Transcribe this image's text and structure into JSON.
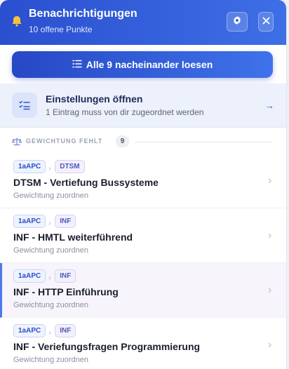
{
  "header": {
    "title": "Benachrichtigungen",
    "subtitle": "10 offene Punkte",
    "icons": {
      "bell": "bell-icon",
      "gear": "gear-icon",
      "close": "close-icon"
    }
  },
  "solve_button": {
    "label": "Alle 9 nacheinander loesen",
    "icon": "list-icon"
  },
  "settings_card": {
    "title": "Einstellungen öffnen",
    "subtitle": "1 Eintrag muss von dir zugeordnet werden",
    "arrow": "→"
  },
  "section": {
    "label": "GEWICHTUNG FEHLT",
    "count": "9",
    "icon": "scale-icon"
  },
  "items": [
    {
      "chip1": "1aAPC",
      "chip2": "DTSM",
      "title": "DTSM - Vertiefung Bussysteme",
      "subtitle": "Gewichtung zuordnen"
    },
    {
      "chip1": "1aAPC",
      "chip2": "INF",
      "title": "INF - HMTL weiterführend",
      "subtitle": "Gewichtung zuordnen"
    },
    {
      "chip1": "1aAPC",
      "chip2": "INF",
      "title": "INF - HTTP Einführung",
      "subtitle": "Gewichtung zuordnen"
    },
    {
      "chip1": "1aAPC",
      "chip2": "INF",
      "title": "INF - Veriefungsfragen Programmierung",
      "subtitle": "Gewichtung zuordnen"
    }
  ],
  "colors": {
    "accent": "#2f56d0",
    "header_start": "#2a4fcf",
    "header_end": "#3e6fe6",
    "bell": "#f5c33b"
  }
}
